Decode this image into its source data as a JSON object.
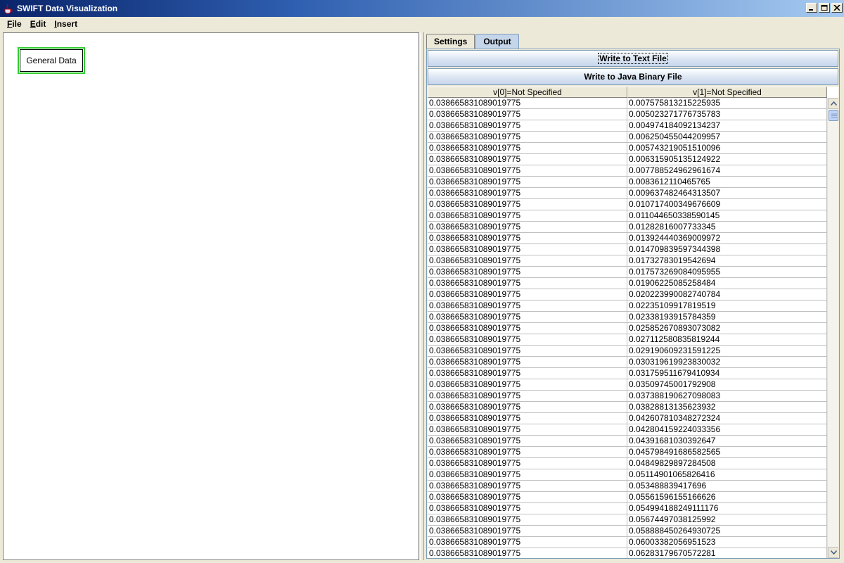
{
  "window": {
    "title": "SWIFT Data Visualization"
  },
  "menu": {
    "items": [
      {
        "label": "File",
        "mnemonic": "F",
        "rest": "ile"
      },
      {
        "label": "Edit",
        "mnemonic": "E",
        "rest": "dit"
      },
      {
        "label": "Insert",
        "mnemonic": "I",
        "rest": "nsert"
      }
    ]
  },
  "canvas": {
    "node_label": "General Data"
  },
  "tabs": [
    {
      "label": "Settings",
      "selected": false
    },
    {
      "label": "Output",
      "selected": true
    }
  ],
  "output": {
    "write_text_label": "Write to Text File",
    "write_binary_label": "Write to Java Binary File",
    "table": {
      "columns": [
        "v[0]=Not Specified",
        "v[1]=Not Specified"
      ],
      "rows": [
        [
          "0.038665831089019775",
          "0.007575813215225935"
        ],
        [
          "0.038665831089019775",
          "0.005023271776735783"
        ],
        [
          "0.038665831089019775",
          "0.004974184092134237"
        ],
        [
          "0.038665831089019775",
          "0.006250455044209957"
        ],
        [
          "0.038665831089019775",
          "0.005743219051510096"
        ],
        [
          "0.038665831089019775",
          "0.006315905135124922"
        ],
        [
          "0.038665831089019775",
          "0.007788524962961674"
        ],
        [
          "0.038665831089019775",
          "0.0083612110465765"
        ],
        [
          "0.038665831089019775",
          "0.009637482464313507"
        ],
        [
          "0.038665831089019775",
          "0.010717400349676609"
        ],
        [
          "0.038665831089019775",
          "0.011044650338590145"
        ],
        [
          "0.038665831089019775",
          "0.01282816007733345"
        ],
        [
          "0.038665831089019775",
          "0.013924440369009972"
        ],
        [
          "0.038665831089019775",
          "0.014709839597344398"
        ],
        [
          "0.038665831089019775",
          "0.01732783019542694"
        ],
        [
          "0.038665831089019775",
          "0.017573269084095955"
        ],
        [
          "0.038665831089019775",
          "0.01906225085258484"
        ],
        [
          "0.038665831089019775",
          "0.020223990082740784"
        ],
        [
          "0.038665831089019775",
          "0.02235109917819519"
        ],
        [
          "0.038665831089019775",
          "0.02338193915784359"
        ],
        [
          "0.038665831089019775",
          "0.025852670893073082"
        ],
        [
          "0.038665831089019775",
          "0.027112580835819244"
        ],
        [
          "0.038665831089019775",
          "0.029190609231591225"
        ],
        [
          "0.038665831089019775",
          "0.030319619923830032"
        ],
        [
          "0.038665831089019775",
          "0.031759511679410934"
        ],
        [
          "0.038665831089019775",
          "0.03509745001792908"
        ],
        [
          "0.038665831089019775",
          "0.037388190627098083"
        ],
        [
          "0.038665831089019775",
          "0.03828813135623932"
        ],
        [
          "0.038665831089019775",
          "0.042607810348272324"
        ],
        [
          "0.038665831089019775",
          "0.042804159224033356"
        ],
        [
          "0.038665831089019775",
          "0.04391681030392647"
        ],
        [
          "0.038665831089019775",
          "0.045798491686582565"
        ],
        [
          "0.038665831089019775",
          "0.04849829897284508"
        ],
        [
          "0.038665831089019775",
          "0.05114901065826416"
        ],
        [
          "0.038665831089019775",
          "0.053488839417696"
        ],
        [
          "0.038665831089019775",
          "0.05561596155166626"
        ],
        [
          "0.038665831089019775",
          "0.054994188249111176"
        ],
        [
          "0.038665831089019775",
          "0.05674497038125992"
        ],
        [
          "0.038665831089019775",
          "0.058888450264930725"
        ],
        [
          "0.038665831089019775",
          "0.06003382056951523"
        ],
        [
          "0.038665831089019775",
          "0.06283179670572281"
        ]
      ]
    }
  },
  "icons": {
    "app": "java-cup-icon",
    "minimize": "minimize-icon",
    "maximize": "maximize-icon",
    "close": "close-icon",
    "scroll_up": "arrow-up-icon",
    "scroll_down": "arrow-down-icon",
    "scroll_thumb": "grip-icon"
  },
  "colors": {
    "title_gradient_start": "#0a246a",
    "title_gradient_end": "#a6caf0",
    "node_border": "#33cc33",
    "tab_selected": "#c5d6ea"
  }
}
